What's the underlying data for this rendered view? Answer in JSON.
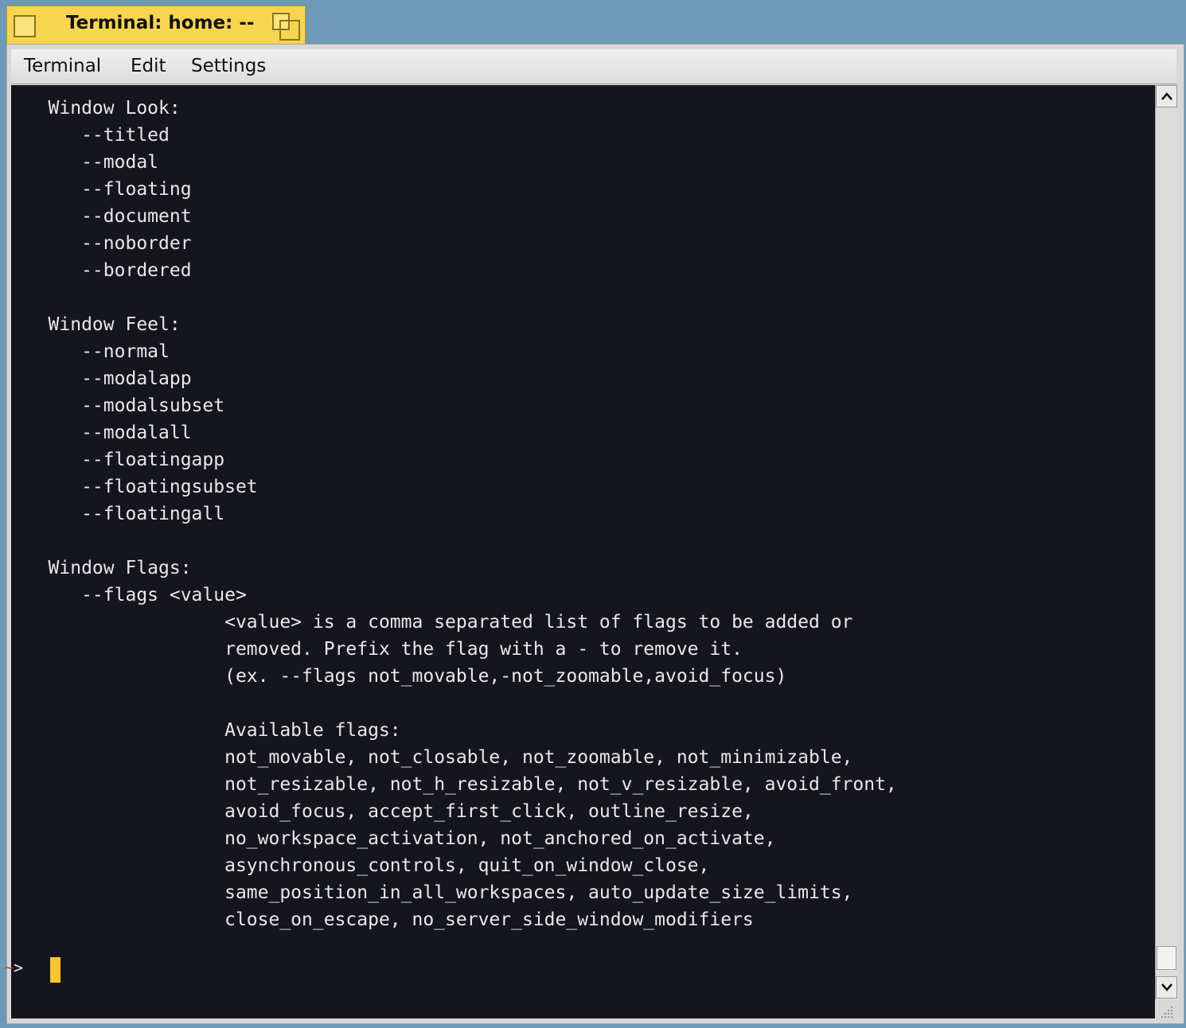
{
  "window": {
    "title": "Terminal: home: --"
  },
  "menu": {
    "items": [
      "Terminal",
      "Edit",
      "Settings"
    ]
  },
  "terminal": {
    "lines": [
      "   Window Look:",
      "      --titled",
      "      --modal",
      "      --floating",
      "      --document",
      "      --noborder",
      "      --bordered",
      "",
      "   Window Feel:",
      "      --normal",
      "      --modalapp",
      "      --modalsubset",
      "      --modalall",
      "      --floatingapp",
      "      --floatingsubset",
      "      --floatingall",
      "",
      "   Window Flags:",
      "      --flags <value>",
      "                   <value> is a comma separated list of flags to be added or",
      "                   removed. Prefix the flag with a - to remove it.",
      "                   (ex. --flags not_movable,-not_zoomable,avoid_focus)",
      "",
      "                   Available flags:",
      "                   not_movable, not_closable, not_zoomable, not_minimizable,",
      "                   not_resizable, not_h_resizable, not_v_resizable, avoid_front,",
      "                   avoid_focus, accept_first_click, outline_resize,",
      "                   no_workspace_activation, not_anchored_on_activate,",
      "                   asynchronous_controls, quit_on_window_close,",
      "                   same_position_in_all_workspaces, auto_update_size_limits,",
      "                   close_on_escape, no_server_side_window_modifiers"
    ],
    "prompt": {
      "tilde": "~",
      "arrow": ">"
    }
  },
  "colors": {
    "tab": "#f8d54e",
    "terminal_bg": "#15161d",
    "terminal_fg": "#e8e8e8",
    "cursor": "#f8c531",
    "prompt_tilde": "#d23b3b"
  },
  "icons": {
    "close": "close-box-icon",
    "zoom": "zoom-box-icon",
    "scroll_up": "arrow-up-icon",
    "scroll_down": "arrow-down-icon",
    "resize": "resize-grip-icon"
  }
}
